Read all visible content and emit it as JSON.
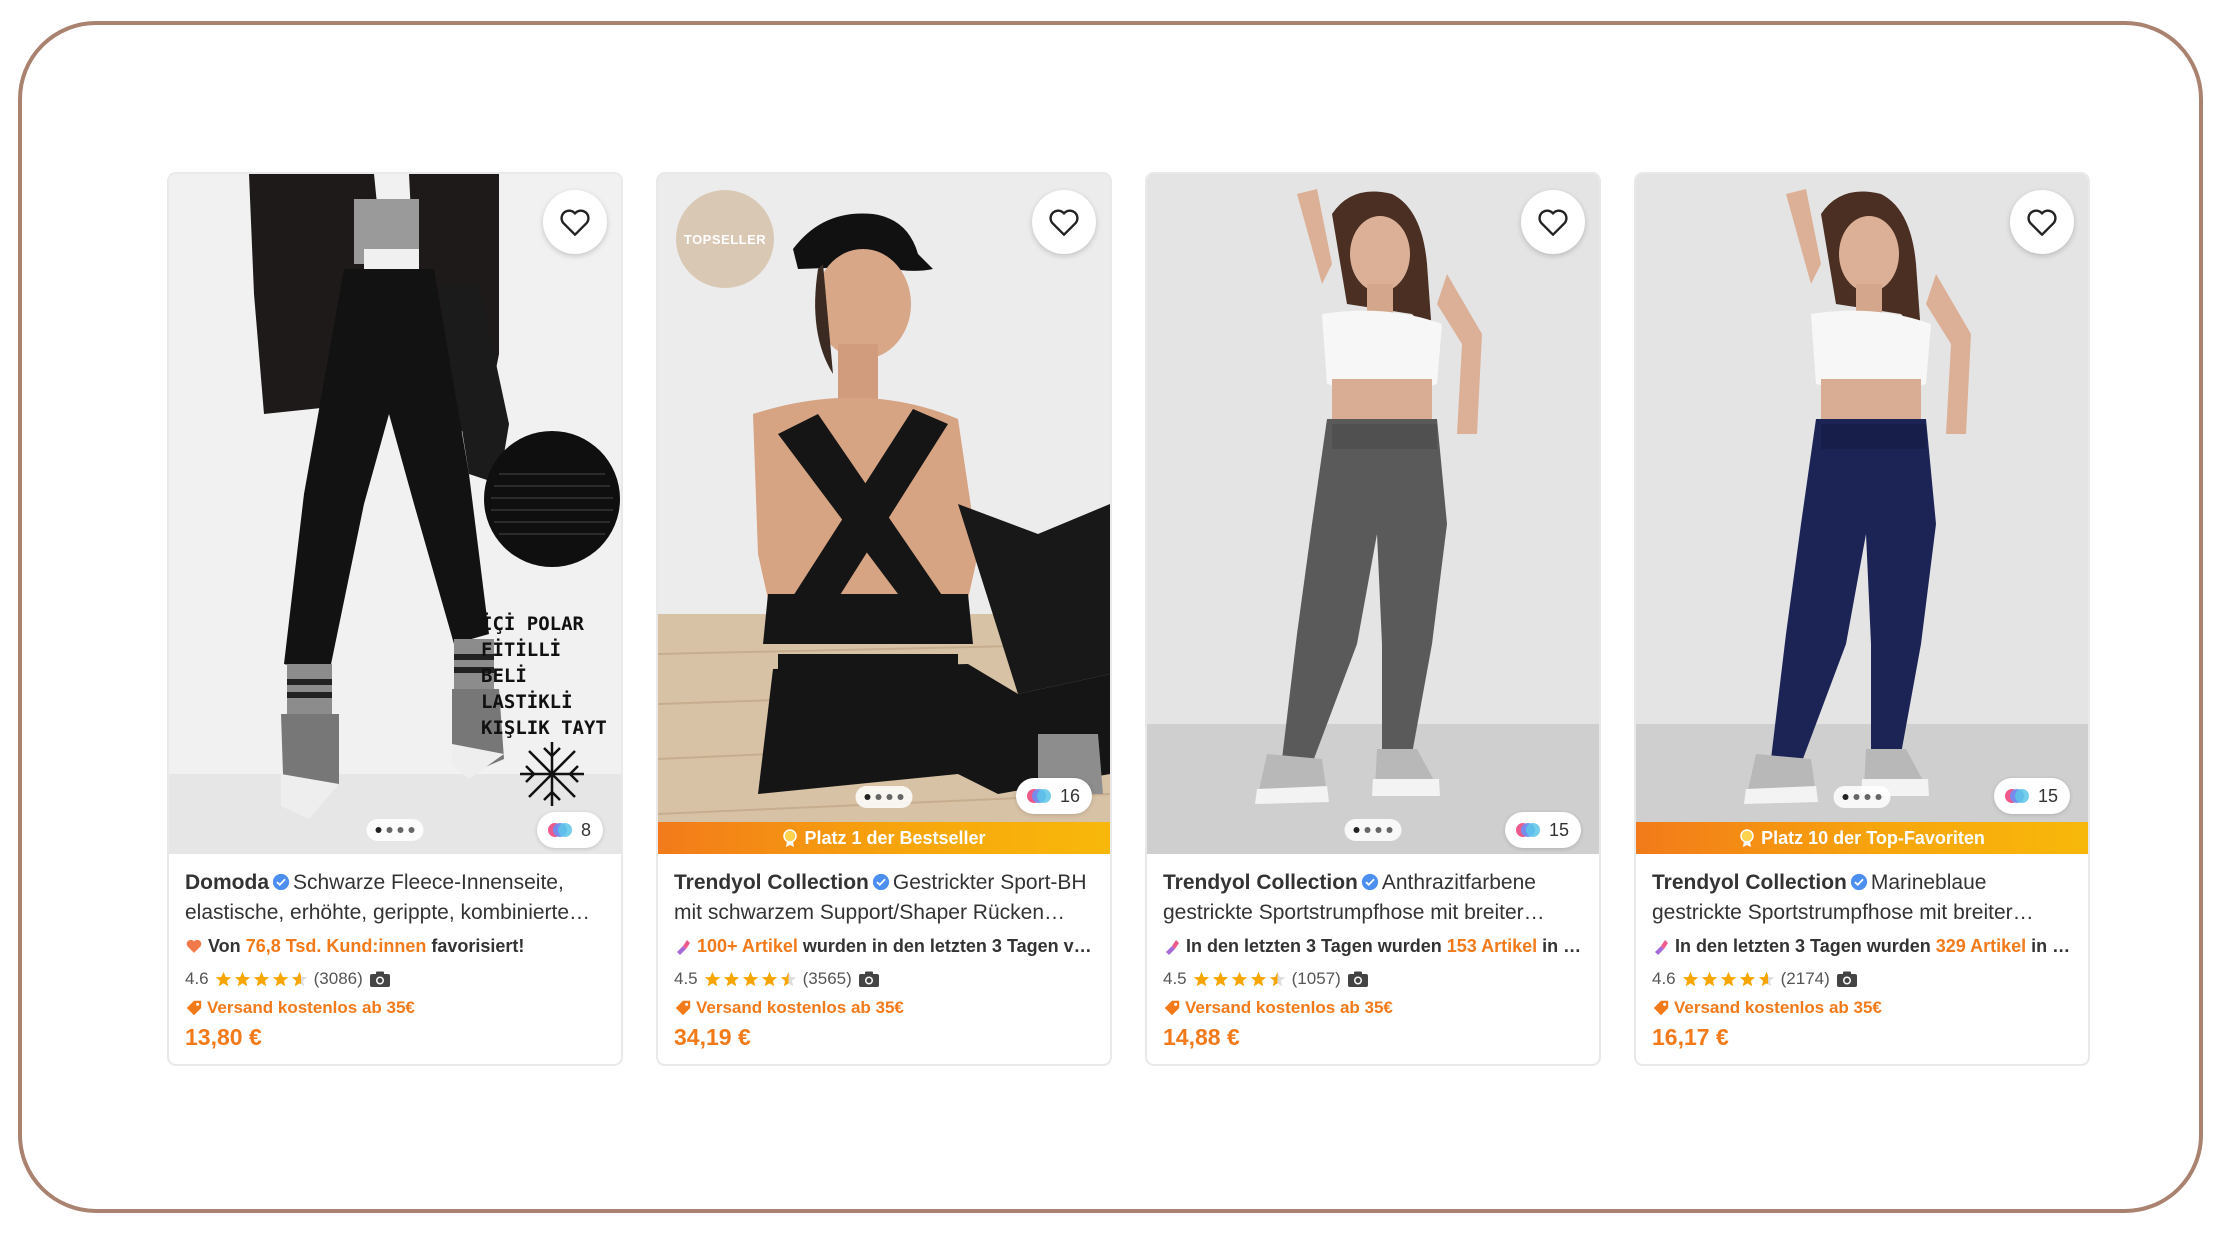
{
  "products": [
    {
      "brand": "Domoda",
      "title": "Schwarze Fleece-Innenseite, elastische, erhöhte, gerippte, kombinierte…",
      "promo_pre": "Von ",
      "promo_hl": "76,8 Tsd. Kund:innen",
      "promo_post": " favorisiert!",
      "promo_icon": "heart-icon",
      "rating": "4.6",
      "reviews": "(3086)",
      "shipping": "Versand kostenlos ab 35€",
      "price": "13,80 €",
      "color_count": "8",
      "image_text": [
        "İÇİ POLAR",
        "FİTİLLİ",
        "BELİ",
        "LASTİKLİ",
        "KIŞLIK TAYT"
      ],
      "ribbon": ""
    },
    {
      "brand": "Trendyol Collection",
      "title": "Gestrickter Sport-BH mit schwarzem Support/Shaper Rücken…",
      "promo_pre": "",
      "promo_hl": "100+ Artikel",
      "promo_post": " wurden in den letzten 3 Tagen v…",
      "promo_icon": "lipstick-icon",
      "rating": "4.5",
      "reviews": "(3565)",
      "shipping": "Versand kostenlos ab 35€",
      "price": "34,19 €",
      "color_count": "16",
      "badge": "TOPSELLER",
      "ribbon": "Platz 1 der Bestseller"
    },
    {
      "brand": "Trendyol Collection",
      "title": "Anthrazitfarbene gestrickte Sportstrumpfhose mit breiter…",
      "promo_pre": "In den letzten 3 Tagen wurden ",
      "promo_hl": "153 Artikel",
      "promo_post": " in …",
      "promo_icon": "lipstick-icon",
      "rating": "4.5",
      "reviews": "(1057)",
      "shipping": "Versand kostenlos ab 35€",
      "price": "14,88 €",
      "color_count": "15",
      "ribbon": ""
    },
    {
      "brand": "Trendyol Collection",
      "title": "Marineblaue gestrickte Sportstrumpfhose mit breiter…",
      "promo_pre": "In den letzten 3 Tagen wurden ",
      "promo_hl": "329 Artikel",
      "promo_post": " in …",
      "promo_icon": "lipstick-icon",
      "rating": "4.6",
      "reviews": "(2174)",
      "shipping": "Versand kostenlos ab 35€",
      "price": "16,17 €",
      "color_count": "15",
      "ribbon": "Platz 10 der Top-Favoriten"
    }
  ],
  "colors": {
    "accent": "#f27a1a",
    "star": "#f7a600",
    "verified": "#4d8ff0",
    "frame": "#a98270"
  }
}
